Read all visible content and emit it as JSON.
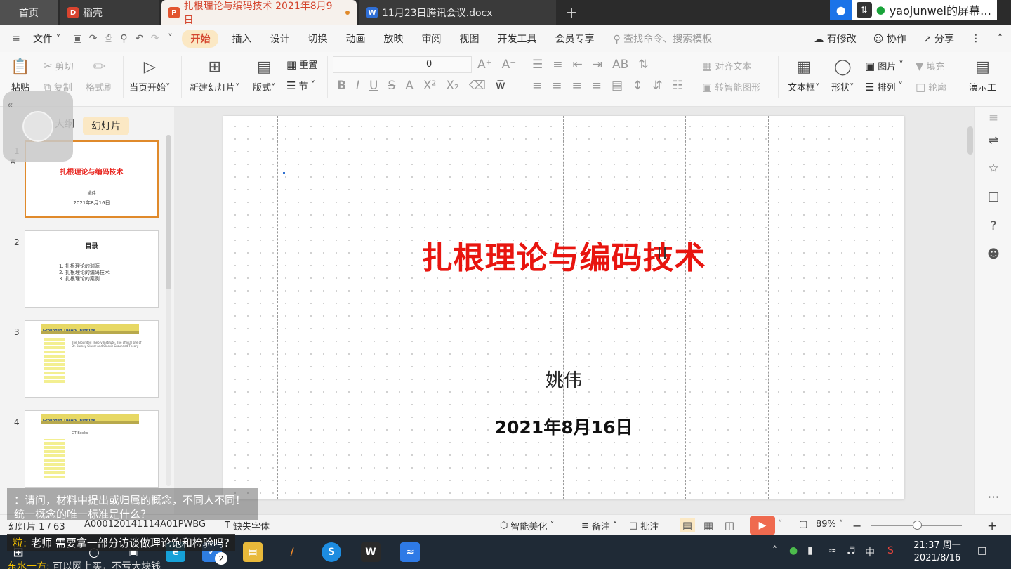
{
  "tabs": {
    "home": "首页",
    "draft": "稻壳",
    "active_doc": "扎根理论与编码技术 2021年8月9日",
    "doc2": "11月23日腾讯会议.docx",
    "add": "+"
  },
  "share_banner": {
    "text": "yaojunwei的屏幕…"
  },
  "menu": {
    "file": "文件",
    "items": [
      "开始",
      "插入",
      "设计",
      "切换",
      "动画",
      "放映",
      "审阅",
      "视图",
      "开发工具",
      "会员专享"
    ],
    "search_placeholder": "查找命令、搜索模板",
    "modified": "有修改",
    "collab": "协作",
    "share": "分享"
  },
  "ribbon": {
    "paste": "粘贴",
    "cut": "剪切",
    "copy": "复制",
    "format_painter": "格式刷",
    "start_current": "当页开始",
    "new_slide": "新建幻灯片",
    "layout": "版式",
    "reset": "重置",
    "section": "节",
    "font_size": "0",
    "align_text": "对齐文本",
    "smart_graphic": "转智能图形",
    "textbox": "文本框",
    "shape": "形状",
    "picture": "图片",
    "arrange": "排列",
    "fill": "填充",
    "outline": "轮廓",
    "present": "演示工"
  },
  "left_panel": {
    "outline_tab": "大纲",
    "slides_tab": "幻灯片",
    "thumbs": [
      {
        "num": "1",
        "title": "扎根理论与编码技术",
        "name": "姚伟",
        "date": "2021年8月16日"
      },
      {
        "num": "2",
        "title": "目录",
        "lines": [
          "1. 扎根理论的渊源",
          "2. 扎根理论的编码技术",
          "3. 扎根理论的案例"
        ]
      },
      {
        "num": "3",
        "header": "Grounded Theory Institute",
        "body": "The Grounded Theory Institute. The official site of Dr. Barney Glaser and Classic Grounded Theory"
      },
      {
        "num": "4",
        "header": "Grounded Theory Institute",
        "body": "GT Books"
      }
    ]
  },
  "slide": {
    "title": "扎根理论与编码技术",
    "author": "姚伟",
    "date": "2021年8月16日"
  },
  "status": {
    "slide_counter": "幻灯片 1 / 63",
    "doc_id": "A000120141114A01PWBG",
    "missing_font": "缺失字体",
    "smart_beautify": "智能美化",
    "notes": "备注",
    "comments": "批注",
    "zoom": "89%"
  },
  "chat": {
    "msg1": "：请问，材料中提出或归属的概念，不同人不同！统一概念的唯一标准是什么？",
    "msg2_who": "粒:",
    "msg2": "老师 需要拿一部分访谈做理论饱和检验吗?",
    "msg3_who": "东水一方:",
    "msg3": "可以网上买，不亏大块钱"
  },
  "taskbar": {
    "badge": "2",
    "ime": "中",
    "time": "21:37 周一",
    "date": "2021/8/16"
  },
  "colors": {
    "accent": "#d4462f",
    "slide_title": "#e8150f",
    "selected_tab_bg": "#fbe8c4"
  }
}
